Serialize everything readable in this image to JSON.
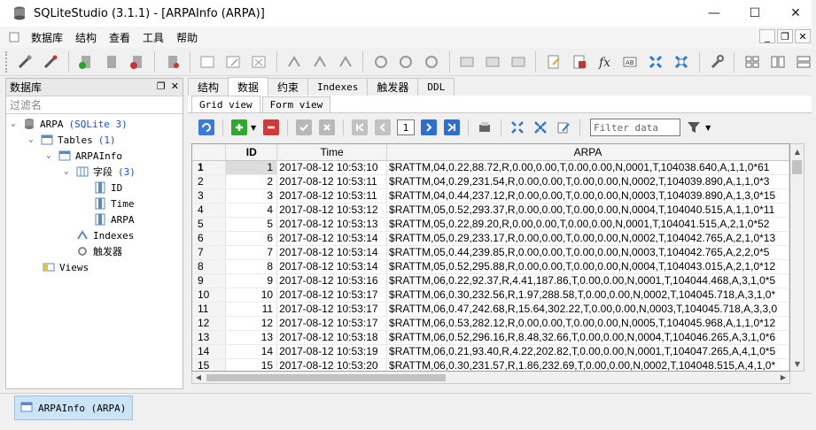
{
  "window": {
    "title": "SQLiteStudio (3.1.1) - [ARPAInfo (ARPA)]",
    "controls": {
      "minimize": "—",
      "maximize": "☐",
      "close": "✕"
    }
  },
  "menu": {
    "items": [
      "数据库",
      "结构",
      "查看",
      "工具",
      "帮助"
    ],
    "mdi": {
      "minimize": "_",
      "restore": "❐",
      "close": "✕"
    }
  },
  "left_panel": {
    "title": "数据库",
    "filter_placeholder": "过滤名",
    "tree": {
      "db_name": "ARPA",
      "db_type": "(SQLite 3)",
      "tables_label": "Tables",
      "tables_count": "(1)",
      "table_name": "ARPAInfo",
      "columns_label": "字段",
      "columns_count": "(3)",
      "columns": [
        "ID",
        "Time",
        "ARPA"
      ],
      "indexes_label": "Indexes",
      "triggers_label": "触发器",
      "views_label": "Views"
    }
  },
  "tabs": [
    "结构",
    "数据",
    "约束",
    "Indexes",
    "触发器",
    "DDL"
  ],
  "active_tab": "数据",
  "subtabs": [
    "Grid view",
    "Form view"
  ],
  "grid_toolbar": {
    "page": "1",
    "filter_placeholder": "Filter data"
  },
  "grid": {
    "columns": [
      "ID",
      "Time",
      "ARPA"
    ],
    "rows": [
      {
        "row": "1",
        "id": "1",
        "time": "2017-08-12 10:53:10",
        "arpa": "$RATTM,04,0.22,88.72,R,0.00,0.00,T,0.00,0.00,N,0001,T,104038.640,A,1,1,0*61"
      },
      {
        "row": "2",
        "id": "2",
        "time": "2017-08-12 10:53:11",
        "arpa": "$RATTM,04,0.29,231.54,R,0.00,0.00,T,0.00,0.00,N,0002,T,104039.890,A,1,1,0*3"
      },
      {
        "row": "3",
        "id": "3",
        "time": "2017-08-12 10:53:11",
        "arpa": "$RATTM,04,0.44,237.12,R,0.00,0.00,T,0.00,0.00,N,0003,T,104039.890,A,1,3,0*15"
      },
      {
        "row": "4",
        "id": "4",
        "time": "2017-08-12 10:53:12",
        "arpa": "$RATTM,05,0.52,293.37,R,0.00,0.00,T,0.00,0.00,N,0004,T,104040.515,A,1,1,0*11"
      },
      {
        "row": "5",
        "id": "5",
        "time": "2017-08-12 10:53:13",
        "arpa": "$RATTM,05,0.22,89.20,R,0.00,0.00,T,0.00,0.00,N,0001,T,104041.515,A,2,1,0*52"
      },
      {
        "row": "6",
        "id": "6",
        "time": "2017-08-12 10:53:14",
        "arpa": "$RATTM,05,0.29,233.17,R,0.00,0.00,T,0.00,0.00,N,0002,T,104042.765,A,2,1,0*13"
      },
      {
        "row": "7",
        "id": "7",
        "time": "2017-08-12 10:53:14",
        "arpa": "$RATTM,05,0.44,239.85,R,0.00,0.00,T,0.00,0.00,N,0003,T,104042.765,A,2,2,0*5"
      },
      {
        "row": "8",
        "id": "8",
        "time": "2017-08-12 10:53:14",
        "arpa": "$RATTM,05,0.52,295.88,R,0.00,0.00,T,0.00,0.00,N,0004,T,104043.015,A,2,1,0*12"
      },
      {
        "row": "9",
        "id": "9",
        "time": "2017-08-12 10:53:16",
        "arpa": "$RATTM,06,0.22,92.37,R,4.41,187.86,T,0.00,0.00,N,0001,T,104044.468,A,3,1,0*5"
      },
      {
        "row": "10",
        "id": "10",
        "time": "2017-08-12 10:53:17",
        "arpa": "$RATTM,06,0.30,232.56,R,1.97,288.58,T,0.00,0.00,N,0002,T,104045.718,A,3,1,0*"
      },
      {
        "row": "11",
        "id": "11",
        "time": "2017-08-12 10:53:17",
        "arpa": "$RATTM,06,0.47,242.68,R,15.64,302.22,T,0.00,0.00,N,0003,T,104045.718,A,3,3,0"
      },
      {
        "row": "12",
        "id": "12",
        "time": "2017-08-12 10:53:17",
        "arpa": "$RATTM,06,0.53,282.12,R,0.00,0.00,T,0.00,0.00,N,0005,T,104045.968,A,1,1,0*12"
      },
      {
        "row": "13",
        "id": "13",
        "time": "2017-08-12 10:53:18",
        "arpa": "$RATTM,06,0.52,296.16,R,8.48,32.66,T,0.00,0.00,N,0004,T,104046.265,A,3,1,0*6"
      },
      {
        "row": "14",
        "id": "14",
        "time": "2017-08-12 10:53:19",
        "arpa": "$RATTM,06,0.21,93.40,R,4.22,202.82,T,0.00,0.00,N,0001,T,104047.265,A,4,1,0*5"
      },
      {
        "row": "15",
        "id": "15",
        "time": "2017-08-12 10:53:20",
        "arpa": "$RATTM,06,0.30,231.57,R,1.86,232.69,T,0.00,0.00,N,0002,T,104048.515,A,4,1,0*"
      }
    ]
  },
  "taskbar": {
    "window_button": "ARPAInfo (ARPA)"
  },
  "colors": {
    "accent": "#1a4fd6",
    "selected_window": "#cce4f7"
  }
}
